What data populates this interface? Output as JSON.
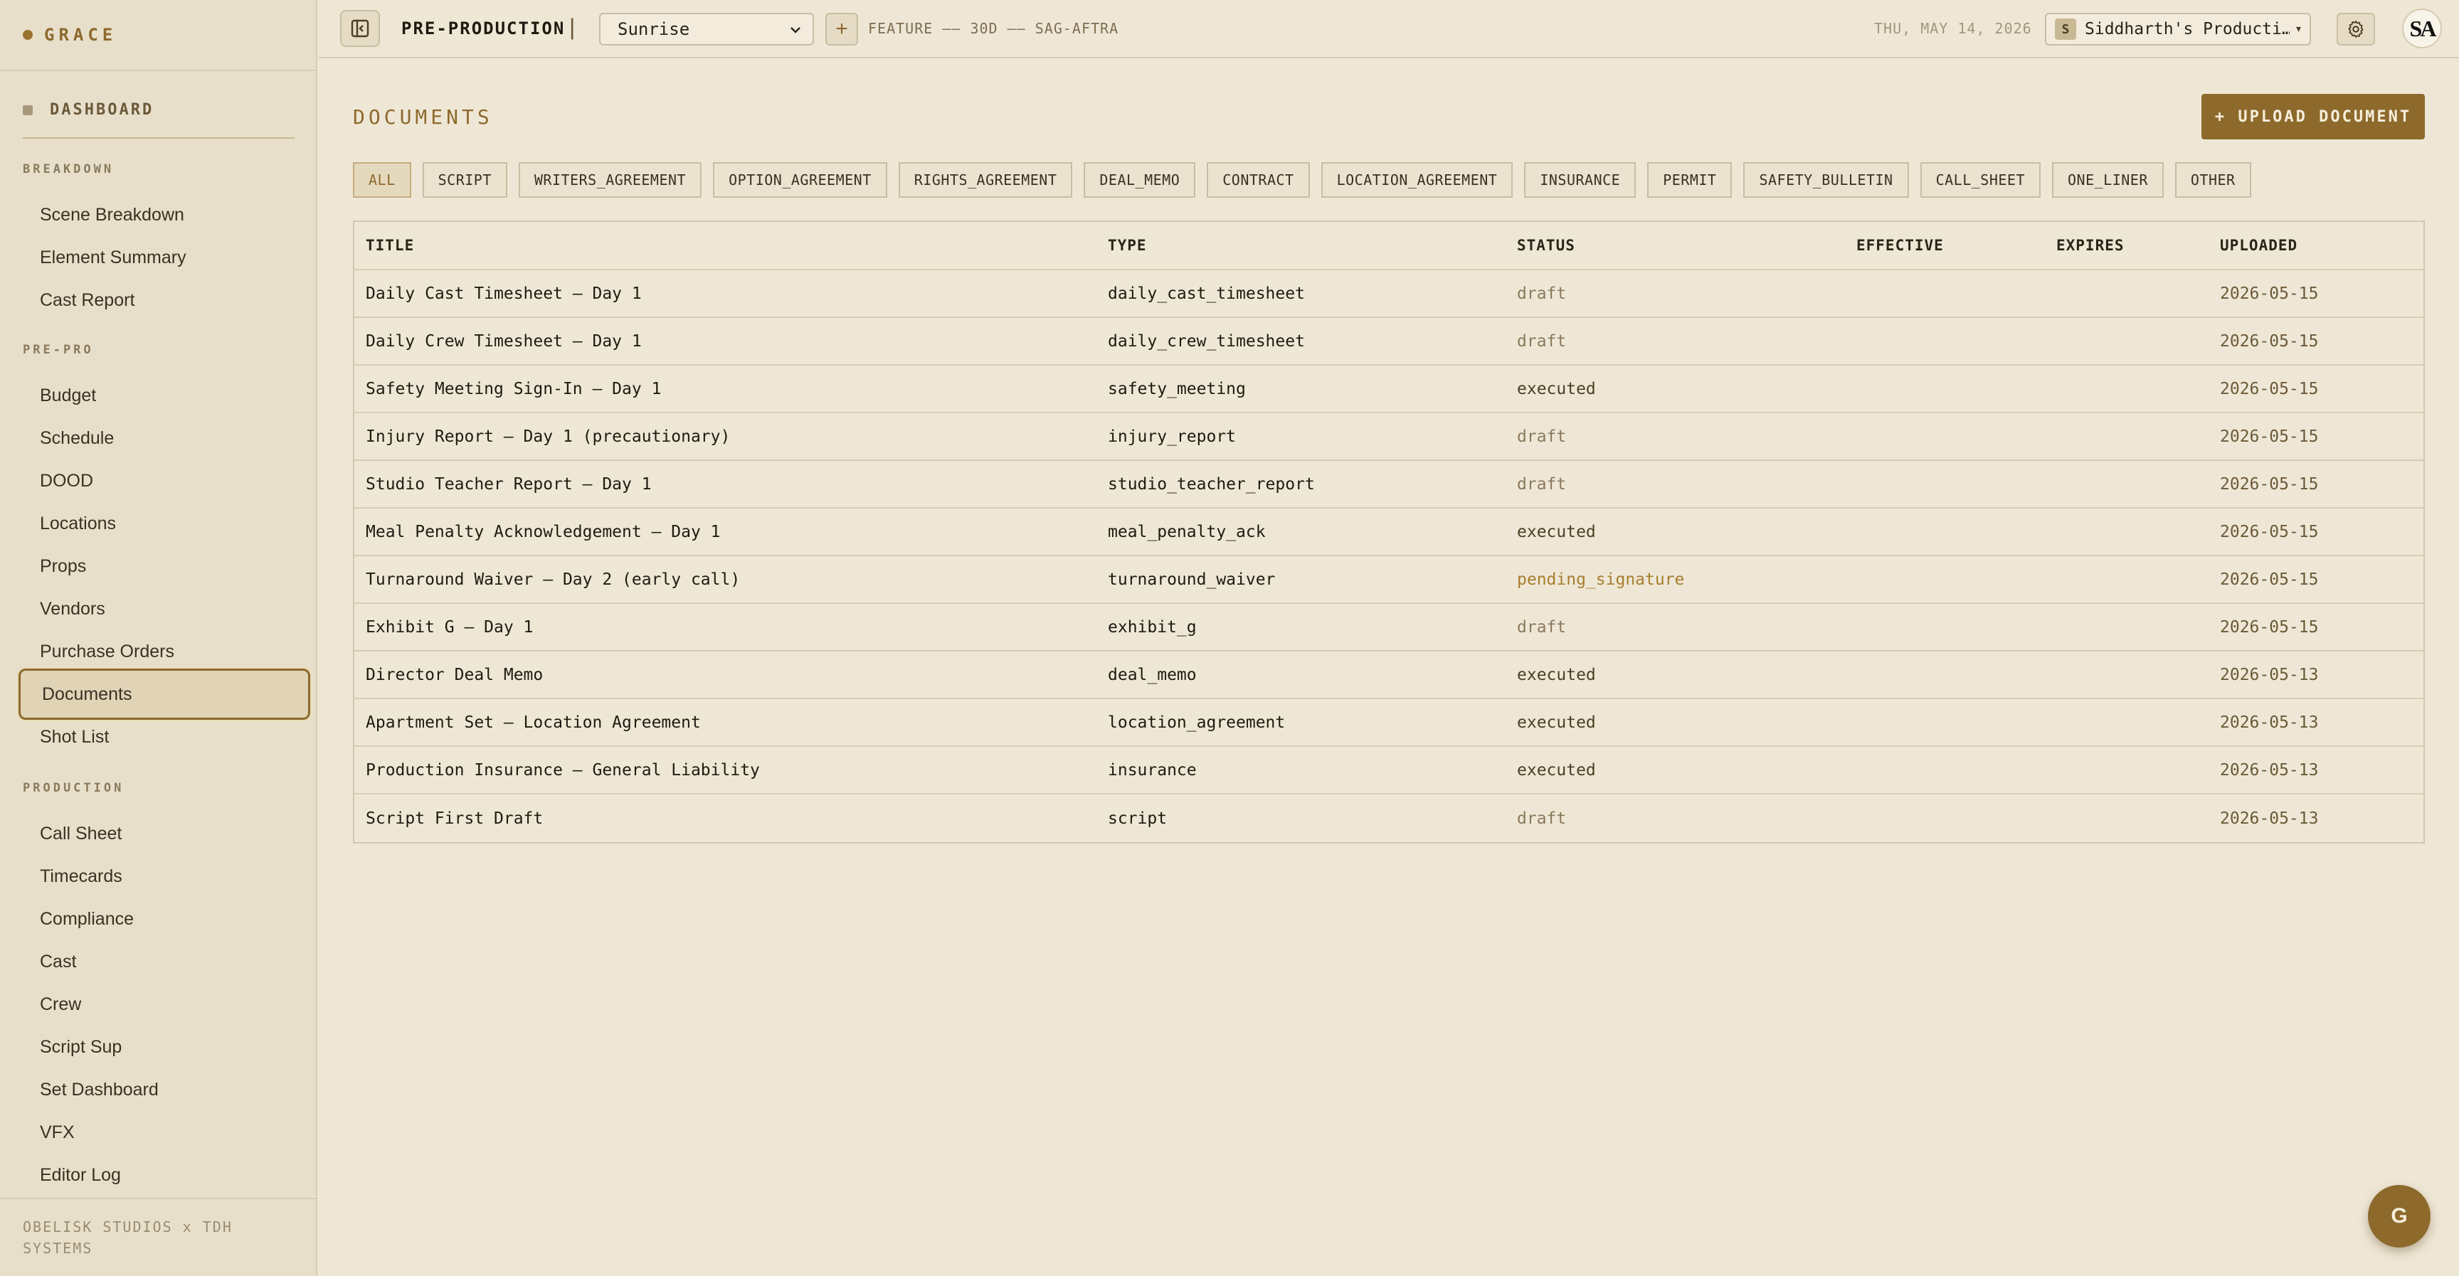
{
  "sidebar": {
    "brand": "GRACE",
    "dashboard": "DASHBOARD",
    "sections": [
      {
        "title": "BREAKDOWN",
        "items": [
          "Scene Breakdown",
          "Element Summary",
          "Cast Report"
        ]
      },
      {
        "title": "PRE-PRO",
        "items": [
          "Budget",
          "Schedule",
          "DOOD",
          "Locations",
          "Props",
          "Vendors",
          "Purchase Orders",
          "Documents",
          "Shot List"
        ]
      },
      {
        "title": "PRODUCTION",
        "items": [
          "Call Sheet",
          "Timecards",
          "Compliance",
          "Cast",
          "Crew",
          "Script Sup",
          "Set Dashboard",
          "VFX",
          "Editor Log"
        ]
      }
    ],
    "active_item": "Documents",
    "footer": "OBELISK STUDIOS x TDH SYSTEMS"
  },
  "topbar": {
    "phase": "PRE-PRODUCTION",
    "separator": "|",
    "project": "Sunrise",
    "add": "+",
    "meta": "FEATURE —— 30D —— SAG-AFTRA",
    "date": "THU, MAY 14, 2026",
    "org_initial": "S",
    "org_name": "Siddharth's Producti…",
    "org_caret": "▾",
    "avatar": "SA"
  },
  "main": {
    "title": "DOCUMENTS",
    "upload_label": "+ UPLOAD DOCUMENT",
    "filters": [
      "ALL",
      "SCRIPT",
      "WRITERS_AGREEMENT",
      "OPTION_AGREEMENT",
      "RIGHTS_AGREEMENT",
      "DEAL_MEMO",
      "CONTRACT",
      "LOCATION_AGREEMENT",
      "INSURANCE",
      "PERMIT",
      "SAFETY_BULLETIN",
      "CALL_SHEET",
      "ONE_LINER",
      "OTHER"
    ],
    "active_filter": "ALL",
    "columns": [
      "TITLE",
      "TYPE",
      "STATUS",
      "EFFECTIVE",
      "EXPIRES",
      "UPLOADED"
    ],
    "rows": [
      {
        "title": "Daily Cast Timesheet — Day 1",
        "type": "daily_cast_timesheet",
        "status": "draft",
        "effective": "",
        "expires": "",
        "uploaded": "2026-05-15"
      },
      {
        "title": "Daily Crew Timesheet — Day 1",
        "type": "daily_crew_timesheet",
        "status": "draft",
        "effective": "",
        "expires": "",
        "uploaded": "2026-05-15"
      },
      {
        "title": "Safety Meeting Sign-In — Day 1",
        "type": "safety_meeting",
        "status": "executed",
        "effective": "",
        "expires": "",
        "uploaded": "2026-05-15"
      },
      {
        "title": "Injury Report — Day 1 (precautionary)",
        "type": "injury_report",
        "status": "draft",
        "effective": "",
        "expires": "",
        "uploaded": "2026-05-15"
      },
      {
        "title": "Studio Teacher Report — Day 1",
        "type": "studio_teacher_report",
        "status": "draft",
        "effective": "",
        "expires": "",
        "uploaded": "2026-05-15"
      },
      {
        "title": "Meal Penalty Acknowledgement — Day 1",
        "type": "meal_penalty_ack",
        "status": "executed",
        "effective": "",
        "expires": "",
        "uploaded": "2026-05-15"
      },
      {
        "title": "Turnaround Waiver — Day 2 (early call)",
        "type": "turnaround_waiver",
        "status": "pending_signature",
        "effective": "",
        "expires": "",
        "uploaded": "2026-05-15"
      },
      {
        "title": "Exhibit G — Day 1",
        "type": "exhibit_g",
        "status": "draft",
        "effective": "",
        "expires": "",
        "uploaded": "2026-05-15"
      },
      {
        "title": "Director Deal Memo",
        "type": "deal_memo",
        "status": "executed",
        "effective": "",
        "expires": "",
        "uploaded": "2026-05-13"
      },
      {
        "title": "Apartment Set — Location Agreement",
        "type": "location_agreement",
        "status": "executed",
        "effective": "",
        "expires": "",
        "uploaded": "2026-05-13"
      },
      {
        "title": "Production Insurance — General Liability",
        "type": "insurance",
        "status": "executed",
        "effective": "",
        "expires": "",
        "uploaded": "2026-05-13"
      },
      {
        "title": "Script First Draft",
        "type": "script",
        "status": "draft",
        "effective": "",
        "expires": "",
        "uploaded": "2026-05-13"
      }
    ]
  },
  "fab": "G"
}
